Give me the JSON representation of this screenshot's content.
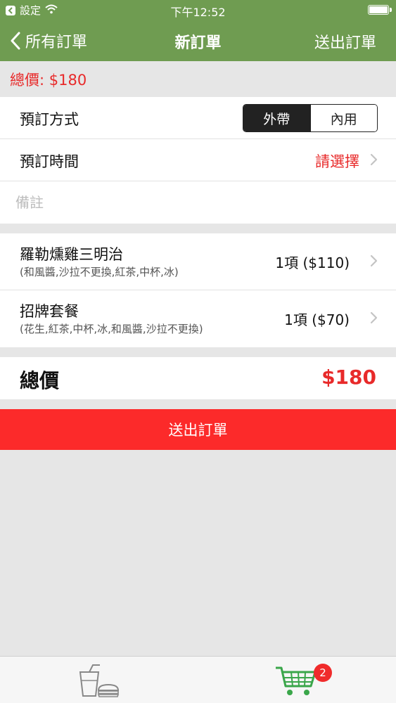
{
  "status_bar": {
    "back_app": "設定",
    "time": "下午12:52"
  },
  "nav": {
    "back_label": "所有訂單",
    "title": "新訂單",
    "action_label": "送出訂單"
  },
  "total_banner": "總價: $180",
  "order_method": {
    "label": "預訂方式",
    "options": [
      "外帶",
      "內用"
    ],
    "selected": "外帶"
  },
  "order_time": {
    "label": "預訂時間",
    "value": "請選擇"
  },
  "notes": {
    "placeholder": "備註",
    "value": ""
  },
  "items": [
    {
      "name": "羅勒燻雞三明治",
      "options": "(和風醬,沙拉不更換,紅茶,中杯,冰)",
      "quantity": "1項 ($110)"
    },
    {
      "name": "招牌套餐",
      "options": "(花生,紅茶,中杯,冰,和風醬,沙拉不更換)",
      "quantity": "1項 ($70)"
    }
  ],
  "summary": {
    "label": "總價",
    "value": "$180"
  },
  "submit_label": "送出訂單",
  "tab_bar": {
    "tabs": [
      {
        "icon": "drink-burger-icon",
        "active": false
      },
      {
        "icon": "cart-icon",
        "active": true,
        "badge": "2"
      }
    ]
  },
  "colors": {
    "nav_green": "#6f9c51",
    "accent_red": "#e82a2a",
    "button_red": "#fc2a2a",
    "background": "#e6e6e6"
  }
}
